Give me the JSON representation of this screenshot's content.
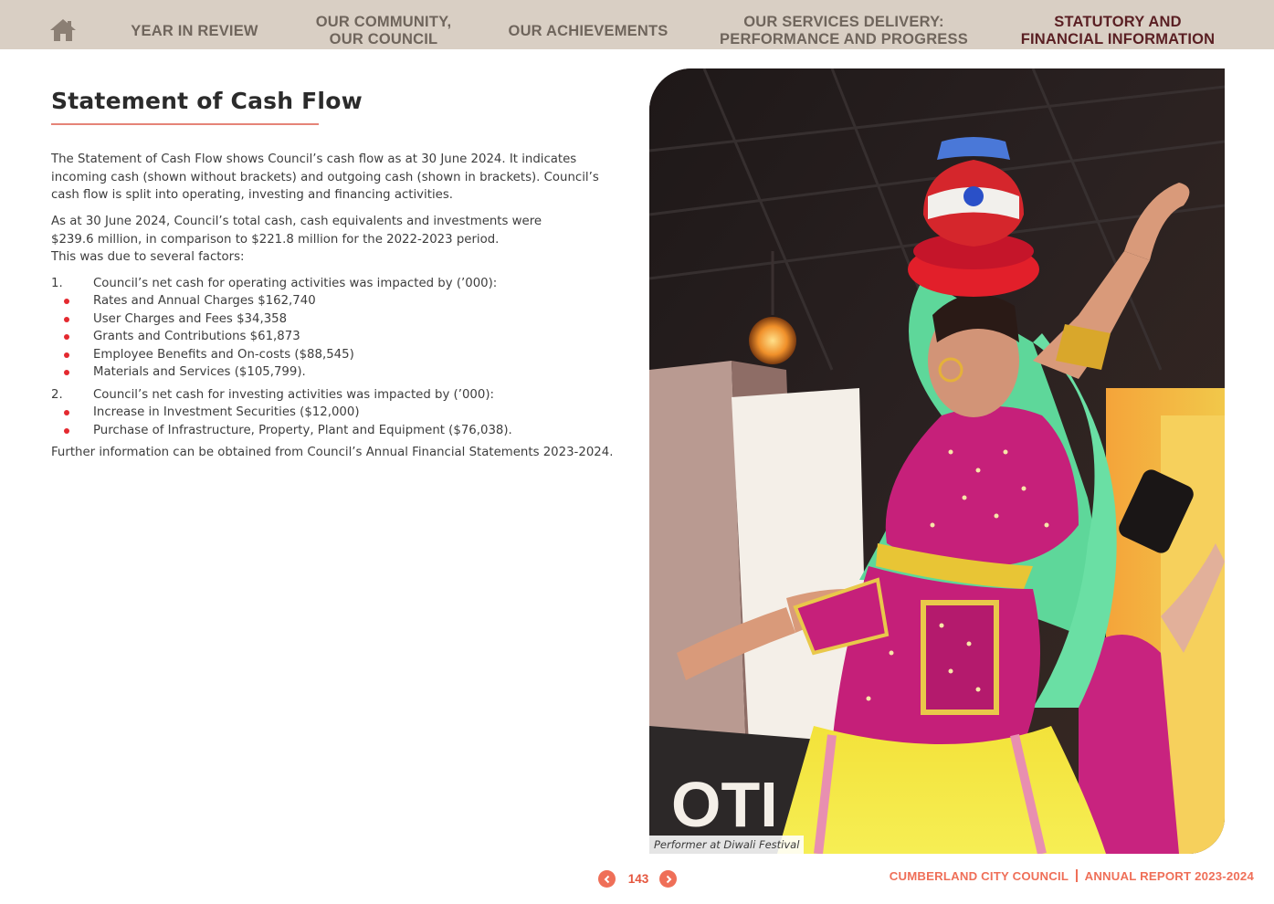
{
  "nav": {
    "home_icon": "home-icon",
    "items": [
      {
        "line1": "YEAR IN REVIEW",
        "line2": ""
      },
      {
        "line1": "OUR COMMUNITY,",
        "line2": "OUR COUNCIL"
      },
      {
        "line1": "OUR ACHIEVEMENTS",
        "line2": ""
      },
      {
        "line1": "OUR SERVICES DELIVERY:",
        "line2": "PERFORMANCE AND PROGRESS"
      },
      {
        "line1": "STATUTORY AND",
        "line2": "FINANCIAL INFORMATION"
      }
    ],
    "active_item": "STATUTORY AND FINANCIAL INFORMATION"
  },
  "page": {
    "title": "Statement of Cash Flow",
    "intro_lines": [
      "The Statement of Cash Flow shows Council’s cash flow as at 30 June 2024. It indicates",
      "incoming cash (shown without brackets) and outgoing cash (shown in brackets). Council’s",
      "cash flow is split into operating, investing and financing activities."
    ],
    "summary_lines": [
      "As at 30 June 2024, Council’s total cash, cash equivalents and investments were",
      "$239.6 million, in comparison to $221.8 million for the 2022-2023 period.",
      "This was due to several factors:"
    ],
    "factors": [
      {
        "number": "1.",
        "text": "Council’s net cash for operating activities was impacted by (’000):",
        "items": [
          "Rates and Annual Charges $162,740",
          "User Charges and Fees $34,358",
          "Grants and Contributions $61,873",
          "Employee Benefits and On-costs ($88,545)",
          "Materials and Services ($105,799)."
        ]
      },
      {
        "number": "2.",
        "text": "Council’s net cash for investing activities was impacted by (’000):",
        "items": [
          "Increase in Investment Securities ($12,000)",
          "Purchase of Infrastructure, Property, Plant and Equipment ($76,038)."
        ]
      }
    ],
    "closing": "Further information can be obtained from Council’s Annual Financial Statements 2023-2024."
  },
  "photo": {
    "caption": "Performer at Diwali Festival"
  },
  "footer": {
    "page_number": "143",
    "prev_icon": "chevron-left-icon",
    "next_icon": "chevron-right-icon",
    "organisation": "CUMBERLAND CITY COUNCIL",
    "report": "ANNUAL REPORT 2023-2024"
  },
  "colors": {
    "nav_background": "#d9cfc4",
    "nav_text": "#6f655c",
    "nav_active": "#5a1f23",
    "accent": "#ef6f58",
    "bullet": "#e4292f"
  }
}
